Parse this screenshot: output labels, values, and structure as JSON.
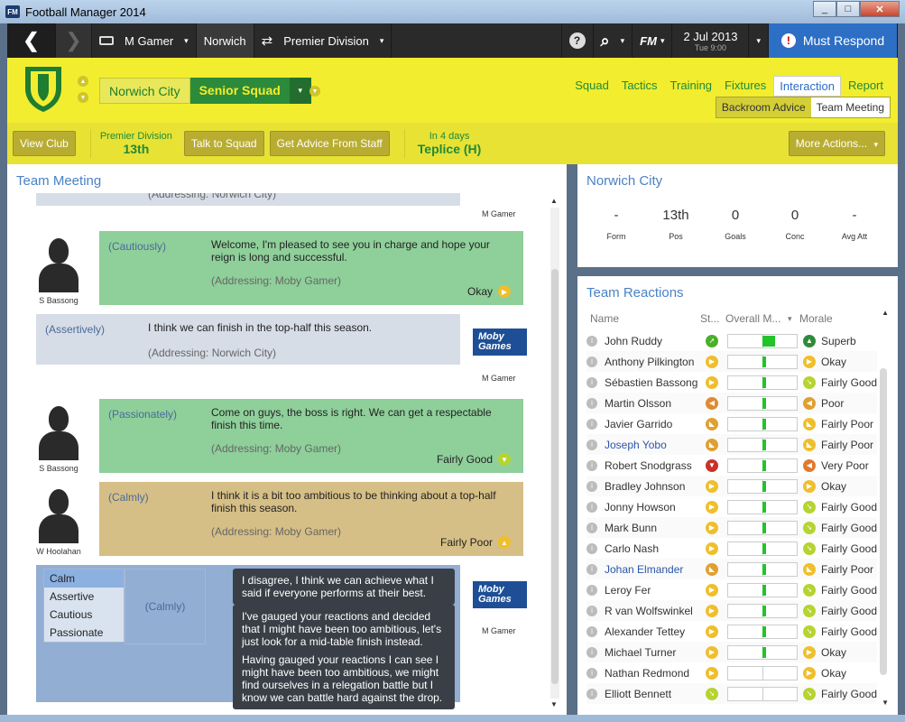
{
  "window": {
    "title": "Football Manager 2014",
    "app_badge": "FM",
    "minimize": "_",
    "maximize": "□",
    "close": "✕"
  },
  "nav": {
    "back": "❮",
    "forward": "❯",
    "manager": "M Gamer",
    "club": "Norwich",
    "competition": "Premier Division",
    "caret": "▾",
    "help": "?",
    "search": "⌕",
    "fm_label": "FM",
    "date": "2 Jul 2013",
    "time": "Tue 9:00",
    "respond_icon": "!",
    "respond": "Must Respond"
  },
  "header": {
    "club_name": "Norwich City",
    "squad_name": "Senior Squad",
    "tabs": [
      {
        "label": "Squad"
      },
      {
        "label": "Tactics"
      },
      {
        "label": "Training"
      },
      {
        "label": "Fixtures"
      },
      {
        "label": "Interaction",
        "active": true
      },
      {
        "label": "Report"
      }
    ],
    "subtabs": [
      {
        "label": "Backroom Advice"
      },
      {
        "label": "Team Meeting",
        "active": true
      }
    ],
    "actions": {
      "view_club": "View Club",
      "league_name": "Premier Division",
      "league_pos": "13th",
      "talk_squad": "Talk to Squad",
      "advice": "Get Advice From Staff",
      "next_when": "In 4 days",
      "next_match": "Teplice (H)",
      "more": "More Actions..."
    }
  },
  "meeting": {
    "title": "Team Meeting",
    "top_addr": "(Addressing: Norwich City)",
    "top_mg": "M Gamer",
    "messages": [
      {
        "speaker": "S Bassong",
        "tone": "(Cautiously)",
        "text": "Welcome, I'm pleased to see you in charge and hope your reign is long and successful.",
        "addressing": "(Addressing: Moby Gamer)",
        "reaction": "Okay"
      },
      {
        "speaker": "M Gamer",
        "tone": "(Assertively)",
        "text": "I think we can finish in the top-half this season.",
        "addressing": "(Addressing: Norwich City)"
      },
      {
        "speaker": "S Bassong",
        "tone": "(Passionately)",
        "text": "Come on guys, the boss is right. We can get a respectable finish this time.",
        "addressing": "(Addressing: Moby Gamer)",
        "reaction": "Fairly Good"
      },
      {
        "speaker": "W Hoolahan",
        "tone": "(Calmly)",
        "text": "I think it is a bit too ambitious to be thinking about a top-half finish this season.",
        "addressing": "(Addressing: Moby Gamer)",
        "reaction": "Fairly Poor"
      }
    ],
    "logo": [
      "Moby",
      "Games"
    ],
    "reply": {
      "tones": [
        "Calm",
        "Assertive",
        "Cautious",
        "Passionate"
      ],
      "selected_tone": "(Calmly)",
      "options": [
        "I disagree, I think we can achieve what I said if everyone performs at their best.",
        "I've gauged your reactions and decided that I might have been too ambitious, let's just look for a mid-table finish instead.",
        "Having gauged your reactions I can see I might have been too ambitious, we might find ourselves in a relegation battle but I know we can battle hard against the drop."
      ],
      "speaker": "M Gamer"
    }
  },
  "club_panel": {
    "title": "Norwich City",
    "stats": [
      {
        "value": "-",
        "label": "Form"
      },
      {
        "value": "13th",
        "label": "Pos"
      },
      {
        "value": "0",
        "label": "Goals"
      },
      {
        "value": "0",
        "label": "Conc"
      },
      {
        "value": "-",
        "label": "Avg Att"
      }
    ]
  },
  "reactions": {
    "title": "Team Reactions",
    "headers": {
      "name": "Name",
      "status": "St...",
      "overall": "Overall M...",
      "sort": "▾",
      "morale": "Morale"
    },
    "players": [
      {
        "name": "John Ruddy",
        "status_color": "#4caf2a",
        "status_glyph": "➚",
        "fill": 0.68,
        "morale": "Superb",
        "morale_color": "#2e8b3a",
        "morale_glyph": "▲"
      },
      {
        "name": "Anthony Pilkington",
        "status_color": "#efbf2b",
        "status_glyph": "▶",
        "fill": 0.55,
        "morale": "Okay",
        "morale_color": "#efbf2b",
        "morale_glyph": "▶"
      },
      {
        "name": "Sébastien Bassong",
        "status_color": "#efbf2b",
        "status_glyph": "▶",
        "fill": 0.55,
        "morale": "Fairly Good",
        "morale_color": "#b5d430",
        "morale_glyph": "➘"
      },
      {
        "name": "Martin Olsson",
        "status_color": "#e08a30",
        "status_glyph": "◀",
        "fill": 0.55,
        "morale": "Poor",
        "morale_color": "#e0a030",
        "morale_glyph": "◀"
      },
      {
        "name": "Javier Garrido",
        "status_color": "#e0a030",
        "status_glyph": "◣",
        "fill": 0.55,
        "morale": "Fairly Poor",
        "morale_color": "#efbf2b",
        "morale_glyph": "◣"
      },
      {
        "name": "Joseph Yobo",
        "link": true,
        "status_color": "#e0a030",
        "status_glyph": "◣",
        "fill": 0.55,
        "morale": "Fairly Poor",
        "morale_color": "#efbf2b",
        "morale_glyph": "◣"
      },
      {
        "name": "Robert Snodgrass",
        "status_color": "#c8322a",
        "status_glyph": "▼",
        "fill": 0.55,
        "morale": "Very Poor",
        "morale_color": "#e07a30",
        "morale_glyph": "◀"
      },
      {
        "name": "Bradley Johnson",
        "status_color": "#efbf2b",
        "status_glyph": "▶",
        "fill": 0.55,
        "morale": "Okay",
        "morale_color": "#efbf2b",
        "morale_glyph": "▶"
      },
      {
        "name": "Jonny Howson",
        "status_color": "#efbf2b",
        "status_glyph": "▶",
        "fill": 0.55,
        "morale": "Fairly Good",
        "morale_color": "#b5d430",
        "morale_glyph": "➘"
      },
      {
        "name": "Mark Bunn",
        "status_color": "#efbf2b",
        "status_glyph": "▶",
        "fill": 0.55,
        "morale": "Fairly Good",
        "morale_color": "#b5d430",
        "morale_glyph": "➘"
      },
      {
        "name": "Carlo Nash",
        "status_color": "#efbf2b",
        "status_glyph": "▶",
        "fill": 0.55,
        "morale": "Fairly Good",
        "morale_color": "#b5d430",
        "morale_glyph": "➘"
      },
      {
        "name": "Johan Elmander",
        "link": true,
        "status_color": "#e0a030",
        "status_glyph": "◣",
        "fill": 0.55,
        "morale": "Fairly Poor",
        "morale_color": "#efbf2b",
        "morale_glyph": "◣"
      },
      {
        "name": "Leroy Fer",
        "status_color": "#efbf2b",
        "status_glyph": "▶",
        "fill": 0.55,
        "morale": "Fairly Good",
        "morale_color": "#b5d430",
        "morale_glyph": "➘"
      },
      {
        "name": "R van Wolfswinkel",
        "status_color": "#efbf2b",
        "status_glyph": "▶",
        "fill": 0.55,
        "morale": "Fairly Good",
        "morale_color": "#b5d430",
        "morale_glyph": "➘"
      },
      {
        "name": "Alexander Tettey",
        "status_color": "#efbf2b",
        "status_glyph": "▶",
        "fill": 0.55,
        "morale": "Fairly Good",
        "morale_color": "#b5d430",
        "morale_glyph": "➘"
      },
      {
        "name": "Michael Turner",
        "status_color": "#efbf2b",
        "status_glyph": "▶",
        "fill": 0.55,
        "morale": "Okay",
        "morale_color": "#efbf2b",
        "morale_glyph": "▶"
      },
      {
        "name": "Nathan Redmond",
        "status_color": "#efbf2b",
        "status_glyph": "▶",
        "fill": 0,
        "morale": "Okay",
        "morale_color": "#efbf2b",
        "morale_glyph": "▶"
      },
      {
        "name": "Elliott Bennett",
        "status_color": "#b5d430",
        "status_glyph": "➘",
        "fill": 0,
        "morale": "Fairly Good",
        "morale_color": "#b5d430",
        "morale_glyph": "➘"
      }
    ]
  },
  "colors": {
    "header_yellow": "#f2ed2f",
    "club_green": "#2c8b3a",
    "accent_blue": "#2d6fc5"
  }
}
